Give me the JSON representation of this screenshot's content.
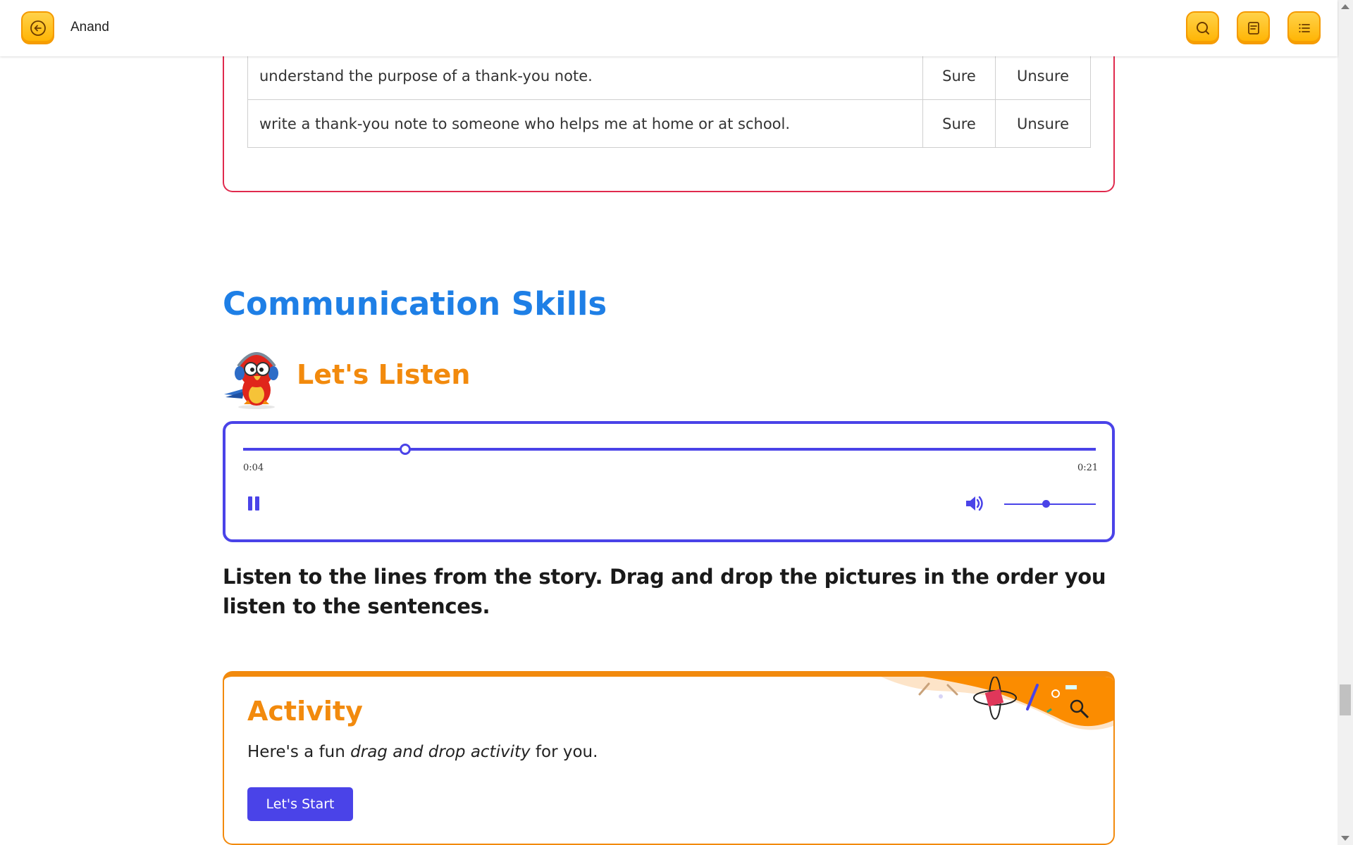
{
  "header": {
    "user_name": "Anand",
    "accent_color": "#ffb300"
  },
  "checklist": {
    "rows": [
      {
        "statement": "understand the purpose of a thank-you note.",
        "sure": "Sure",
        "unsure": "Unsure"
      },
      {
        "statement": "write a thank-you note to someone who helps me at home or at school.",
        "sure": "Sure",
        "unsure": "Unsure"
      }
    ],
    "border_color": "#e02a4d"
  },
  "section": {
    "title": "Communication Skills",
    "color": "#1e7fe6"
  },
  "listen": {
    "title": "Let's Listen",
    "color": "#f28a0d"
  },
  "player": {
    "current_time": "0:04",
    "duration": "0:21",
    "progress_fraction": 0.19,
    "volume_fraction": 0.45,
    "state": "playing",
    "color": "#4a43e8"
  },
  "instruction": "Listen to the lines from the story. Drag and drop the pictures in the order you listen to the sentences.",
  "activity": {
    "title": "Activity",
    "text_before": "Here's a fun ",
    "text_emphasis": "drag and drop activity",
    "text_after": " for you.",
    "start_label": "Let's Start",
    "border_color": "#f28a0d"
  }
}
